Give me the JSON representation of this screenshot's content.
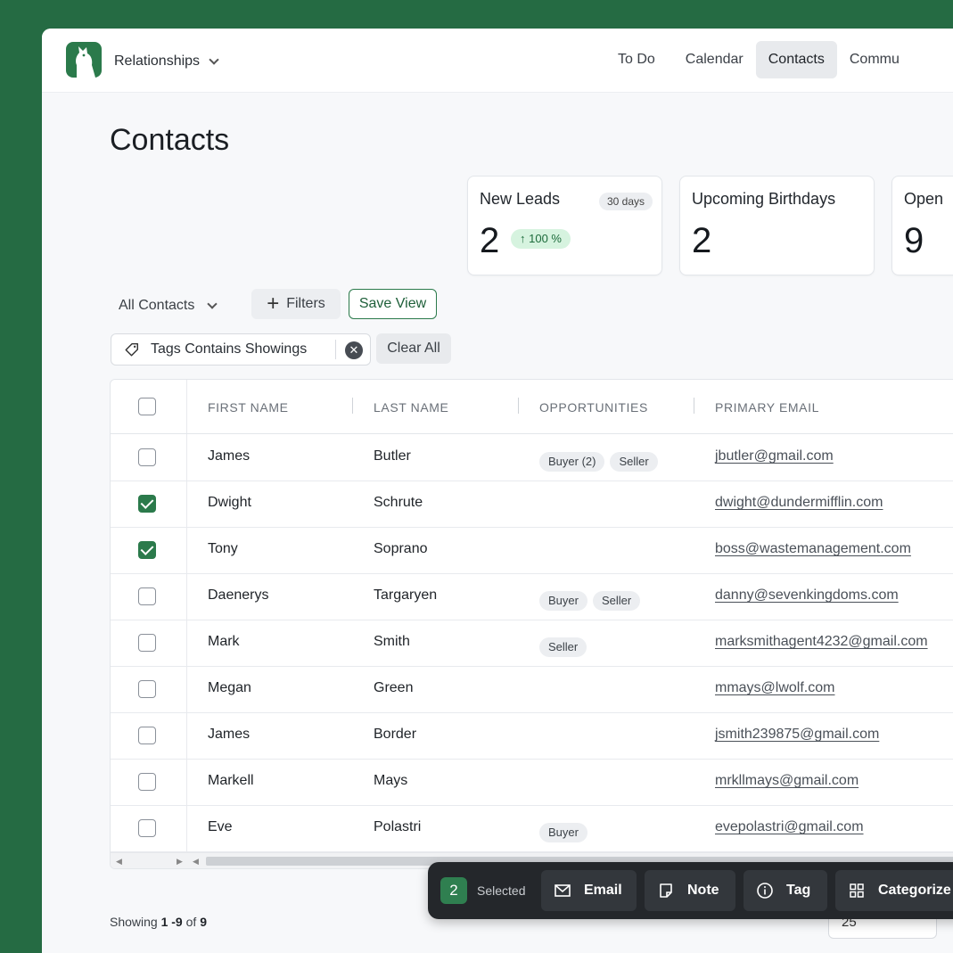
{
  "header": {
    "app_name": "Relationships",
    "nav": [
      {
        "label": "To Do"
      },
      {
        "label": "Calendar"
      },
      {
        "label": "Contacts",
        "active": true
      },
      {
        "label": "Commu"
      }
    ]
  },
  "page": {
    "title": "Contacts"
  },
  "cards": [
    {
      "title": "New Leads",
      "badge": "30 days",
      "value": "2",
      "trend": "↑ 100 %"
    },
    {
      "title": "Upcoming Birthdays",
      "value": "2"
    },
    {
      "title": "Open",
      "value": "9"
    }
  ],
  "toolbar": {
    "view_label": "All Contacts",
    "filters_label": "Filters",
    "save_view_label": "Save View",
    "active_filter": "Tags Contains Showings",
    "clear_all_label": "Clear All"
  },
  "table": {
    "columns": [
      "FIRST NAME",
      "LAST NAME",
      "OPPORTUNITIES",
      "PRIMARY EMAIL"
    ],
    "rows": [
      {
        "first": "James",
        "last": "Butler",
        "opps": [
          "Buyer (2)",
          "Seller"
        ],
        "email": "jbutler@gmail.com",
        "checked": false
      },
      {
        "first": "Dwight",
        "last": "Schrute",
        "opps": [],
        "email": "dwight@dundermifflin.com",
        "checked": true
      },
      {
        "first": "Tony",
        "last": "Soprano",
        "opps": [],
        "email": "boss@wastemanagement.com",
        "checked": true
      },
      {
        "first": "Daenerys",
        "last": "Targaryen",
        "opps": [
          "Buyer",
          "Seller"
        ],
        "email": "danny@sevenkingdoms.com",
        "checked": false
      },
      {
        "first": "Mark",
        "last": "Smith",
        "opps": [
          "Seller"
        ],
        "email": "marksmithagent4232@gmail.com",
        "checked": false
      },
      {
        "first": "Megan",
        "last": "Green",
        "opps": [],
        "email": "mmays@lwolf.com",
        "checked": false
      },
      {
        "first": "James",
        "last": "Border",
        "opps": [],
        "email": "jsmith239875@gmail.com",
        "checked": false
      },
      {
        "first": "Markell",
        "last": "Mays",
        "opps": [],
        "email": "mrkllmays@gmail.com",
        "checked": false
      },
      {
        "first": "Eve",
        "last": "Polastri",
        "opps": [
          "Buyer"
        ],
        "email": "evepolastri@gmail.com",
        "checked": false
      }
    ]
  },
  "selection_bar": {
    "count": "2",
    "label": "Selected",
    "actions": [
      {
        "label": "Email",
        "icon": "envelope-icon"
      },
      {
        "label": "Note",
        "icon": "note-icon"
      },
      {
        "label": "Tag",
        "icon": "info-circle-icon"
      },
      {
        "label": "Categorize",
        "icon": "grid-icon"
      }
    ]
  },
  "footer": {
    "showing_prefix": "Showing ",
    "range": "1 -9",
    "of_text": " of ",
    "total": "9",
    "page_size": "25"
  },
  "colors": {
    "brand": "#2b7a4b",
    "background": "#256b43",
    "toolbar_dark": "#24272b"
  }
}
